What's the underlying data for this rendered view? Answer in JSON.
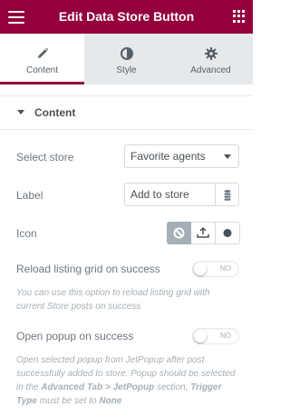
{
  "header": {
    "title": "Edit Data Store Button",
    "menu_icon": "hamburger-icon",
    "apps_icon": "grid-icon"
  },
  "tabs": [
    {
      "label": "Content",
      "icon": "pencil-icon",
      "active": true
    },
    {
      "label": "Style",
      "icon": "contrast-icon",
      "active": false
    },
    {
      "label": "Advanced",
      "icon": "gear-icon",
      "active": false
    }
  ],
  "section": {
    "title": "Content"
  },
  "fields": {
    "select_store": {
      "label": "Select store",
      "value": "Favorite agents"
    },
    "label": {
      "label": "Label",
      "value": "Add to store"
    },
    "icon": {
      "label": "Icon",
      "options": [
        "none-icon",
        "upload-icon",
        "circle-icon"
      ],
      "selected": 0
    },
    "reload": {
      "label": "Reload listing grid on success",
      "toggle": "NO",
      "help": "You can use this option to reload listing grid with current Store posts on success"
    },
    "open_popup": {
      "label": "Open popup on success",
      "toggle": "NO",
      "help_1": "Open selected popup from JetPopup after post successfully added to store. Popup should be selected in the ",
      "help_bold_1": "Advanced Tab > JetPopup",
      "help_2": " section, ",
      "help_bold_2": "Trigger Type",
      "help_3": " must be set to ",
      "help_bold_3": "None"
    }
  },
  "colors": {
    "brand": "#93003c",
    "active_choice": "#a4afb7"
  }
}
